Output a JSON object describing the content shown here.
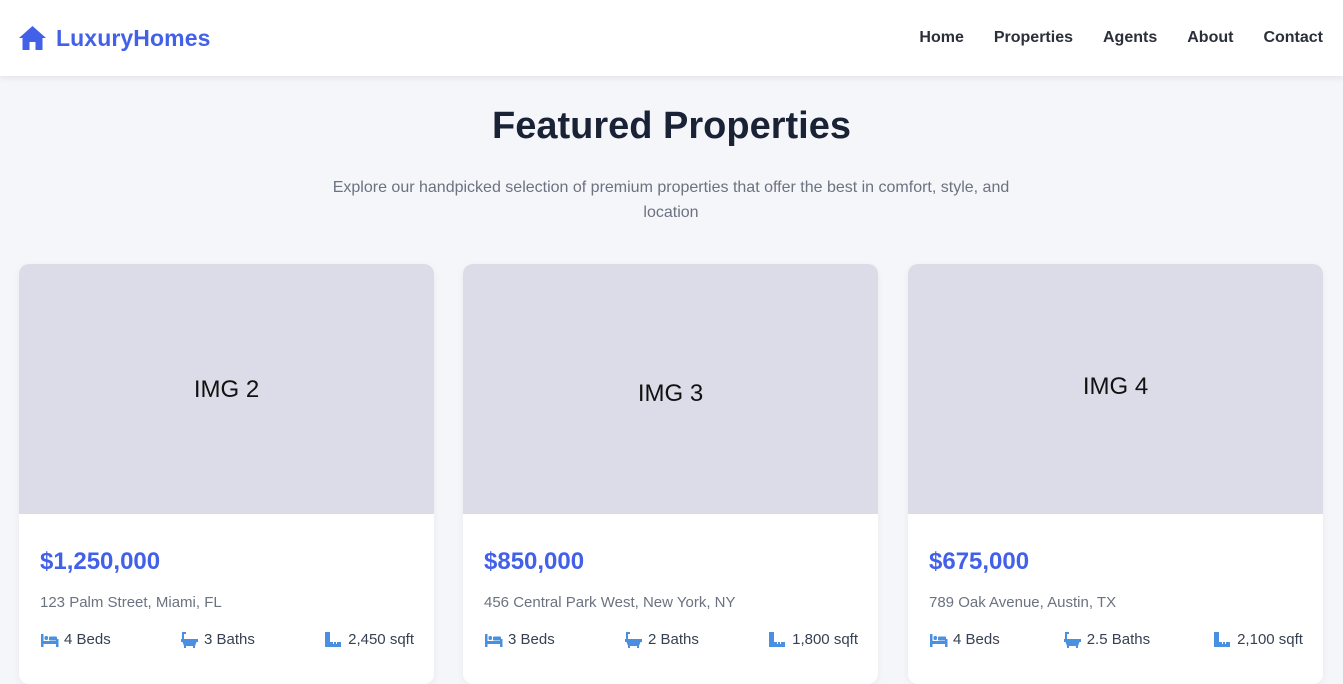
{
  "brand": {
    "name": "LuxuryHomes",
    "icon": "house-icon",
    "color": "#4361e8"
  },
  "nav": [
    {
      "label": "Home"
    },
    {
      "label": "Properties"
    },
    {
      "label": "Agents"
    },
    {
      "label": "About"
    },
    {
      "label": "Contact"
    }
  ],
  "section": {
    "title": "Featured Properties",
    "subtitle": "Explore our handpicked selection of premium properties that offer the best in comfort, style, and location"
  },
  "properties": [
    {
      "image_label": "IMG 2",
      "price": "$1,250,000",
      "address": "123 Palm Street, Miami, FL",
      "beds": "4 Beds",
      "baths": "3 Baths",
      "area": "2,450 sqft"
    },
    {
      "image_label": "IMG 3",
      "price": "$850,000",
      "address": "456 Central Park West, New York, NY",
      "beds": "3 Beds",
      "baths": "2 Baths",
      "area": "1,800 sqft"
    },
    {
      "image_label": "IMG 4",
      "price": "$675,000",
      "address": "789 Oak Avenue, Austin, TX",
      "beds": "4 Beds",
      "baths": "2.5 Baths",
      "area": "2,100 sqft"
    }
  ],
  "icons": {
    "beds": "bed-icon",
    "baths": "bath-icon",
    "area": "ruler-icon"
  },
  "colors": {
    "accent": "#4361e8",
    "icon_blue": "#4a8fe0",
    "placeholder": "#dcdbe8",
    "background": "#f5f6fa"
  }
}
